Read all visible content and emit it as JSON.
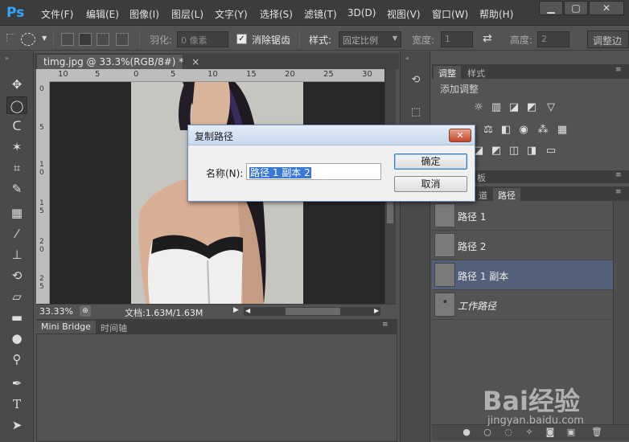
{
  "app": {
    "logo": "Ps",
    "window_controls": [
      "minimize-icon",
      "restore-icon",
      "close-icon"
    ]
  },
  "menu": [
    "文件(F)",
    "编辑(E)",
    "图像(I)",
    "图层(L)",
    "文字(Y)",
    "选择(S)",
    "滤镜(T)",
    "3D(D)",
    "视图(V)",
    "窗口(W)",
    "帮助(H)"
  ],
  "options": {
    "feather_label": "羽化:",
    "feather_value": "0 像素",
    "antialias_label": "消除锯齿",
    "antialias_checked": true,
    "style_label": "样式:",
    "style_value": "固定比例",
    "width_label": "宽度:",
    "width_value": "1",
    "height_label": "高度:",
    "height_value": "2",
    "refine_edge_label": "调整边"
  },
  "document": {
    "tab_title": "timg.jpg @ 33.3%(RGB/8#) *",
    "close_glyph": "×",
    "ruler_top_ticks": [
      "10",
      "5",
      "0",
      "5",
      "10",
      "15",
      "20",
      "25",
      "30"
    ],
    "ruler_left_ticks": [
      "0",
      "5",
      "1\n0",
      "1\n5",
      "2\n0",
      "2\n5"
    ],
    "zoom": "33.33%",
    "doc_info": "文档:1.63M/1.63M"
  },
  "bottom_panel": {
    "tabs": [
      "Mini Bridge",
      "时间轴"
    ]
  },
  "adjustments_panel": {
    "tabs": [
      "调整",
      "样式"
    ],
    "heading": "添加调整"
  },
  "paths_panel": {
    "top_tab_partial": "板",
    "tabs_partial": [
      "道",
      "路径"
    ],
    "rows": [
      {
        "name": "路径 1",
        "selected": false,
        "italic": false
      },
      {
        "name": "路径 2",
        "selected": false,
        "italic": false
      },
      {
        "name": "路径 1 副本",
        "selected": true,
        "italic": false
      },
      {
        "name": "工作路径",
        "selected": false,
        "italic": true
      }
    ]
  },
  "dialog": {
    "title": "复制路径",
    "close_glyph": "✕",
    "name_label": "名称(N):",
    "name_value": "路径 1 副本 2",
    "ok_label": "确定",
    "cancel_label": "取消"
  },
  "watermark": {
    "brand": "Bai经验",
    "url": "jingyan.baidu.com"
  },
  "colors": {
    "accent_ps": "#31a8ff",
    "selected_row": "#53607a",
    "dialog_selection": "#3a78d6"
  }
}
